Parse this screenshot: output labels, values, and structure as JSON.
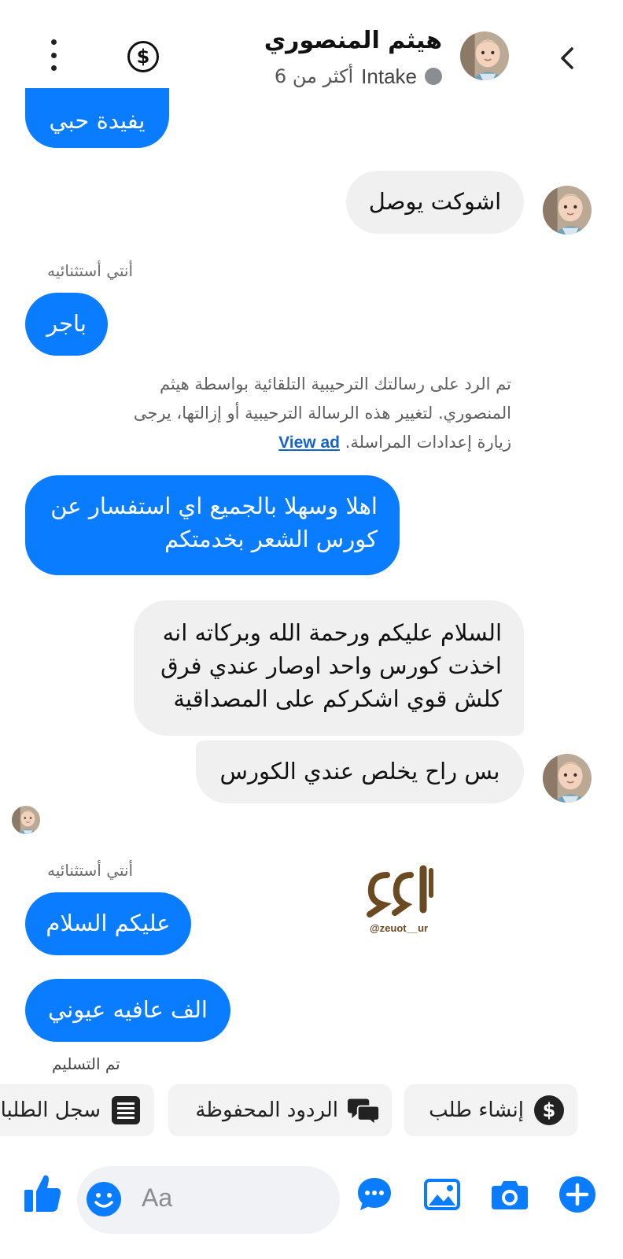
{
  "header": {
    "contact_name": "هيثم المنصوري",
    "status_label": "Intake",
    "status_time": "أكثر من 6"
  },
  "messages": {
    "m0_text": "يفيدة حبي",
    "m1_text": "اشوكت يوصل",
    "label1": "أنتي أستثنائيه",
    "m2_text": "باجر",
    "system_note": "تم الرد على رسالتك الترحيبية التلقائية بواسطة هيثم المنصوري. لتغيير هذه الرسالة الترحيبية أو إزالتها، يرجى زيارة إعدادات المراسلة.",
    "view_ad_link": "View ad",
    "m3_line1": "اهلا وسهلا بالجميع اي استفسار عن",
    "m3_line2": "كورس الشعر بخدمتكم",
    "m4_line1": "السلام عليكم ورحمة الله وبركاته انه",
    "m4_line2": "اخذت كورس واحد اوصار عندي فرق",
    "m4_line3": "كلش قوي اشكركم على المصداقية",
    "m5_text": "بس راح يخلص عندي الكورس",
    "label2": "أنتي أستثنائيه",
    "m6_text": "عليكم السلام",
    "m7_text": "الف عافيه عيوني",
    "delivered": "تم التسليم"
  },
  "watermark": {
    "handle": "@zeuot__ur"
  },
  "quick_replies": [
    {
      "label": "إنشاء طلب",
      "icon": "dollar-circle-icon"
    },
    {
      "label": "الردود المحفوظة",
      "icon": "chat-bubbles-icon"
    },
    {
      "label": "سجل الطلبات",
      "icon": "list-icon"
    }
  ],
  "composer": {
    "placeholder": "Aa"
  },
  "colors": {
    "accent": "#0a7cff",
    "incoming_bubble": "#f0f0f0",
    "status_dot": "#8a8d91"
  }
}
